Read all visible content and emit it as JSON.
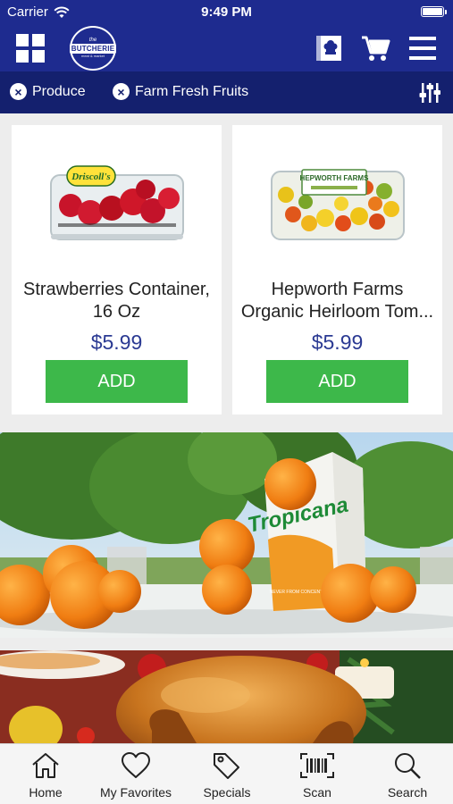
{
  "status_bar": {
    "carrier": "Carrier",
    "time": "9:49 PM"
  },
  "header": {
    "logo": {
      "top": "the",
      "word": "BUTCHERIE",
      "sub": "meat & market"
    }
  },
  "filters": {
    "chips": [
      {
        "label": "Produce"
      },
      {
        "label": "Farm Fresh Fruits"
      }
    ]
  },
  "products": [
    {
      "name": "Strawberries Container, 16 Oz",
      "price": "$5.99",
      "add_label": "ADD",
      "package_label": "Driscoll's"
    },
    {
      "name": "Hepworth Farms Organic Heirloom Tom...",
      "price": "$5.99",
      "add_label": "ADD",
      "package_label": "HEPWORTH FARMS"
    }
  ],
  "banners": {
    "juice": {
      "brand": "Tropicana",
      "tag": "NEVER FROM CONCENTRATE"
    }
  },
  "tabs": [
    {
      "label": "Home",
      "icon": "home-icon"
    },
    {
      "label": "My Favorites",
      "icon": "heart-icon"
    },
    {
      "label": "Specials",
      "icon": "tag-icon"
    },
    {
      "label": "Scan",
      "icon": "barcode-icon"
    },
    {
      "label": "Search",
      "icon": "search-icon"
    }
  ],
  "colors": {
    "header_bg": "#1e2b8f",
    "filter_bg": "#14206e",
    "price": "#2b3a93",
    "add_button": "#3db84a"
  }
}
